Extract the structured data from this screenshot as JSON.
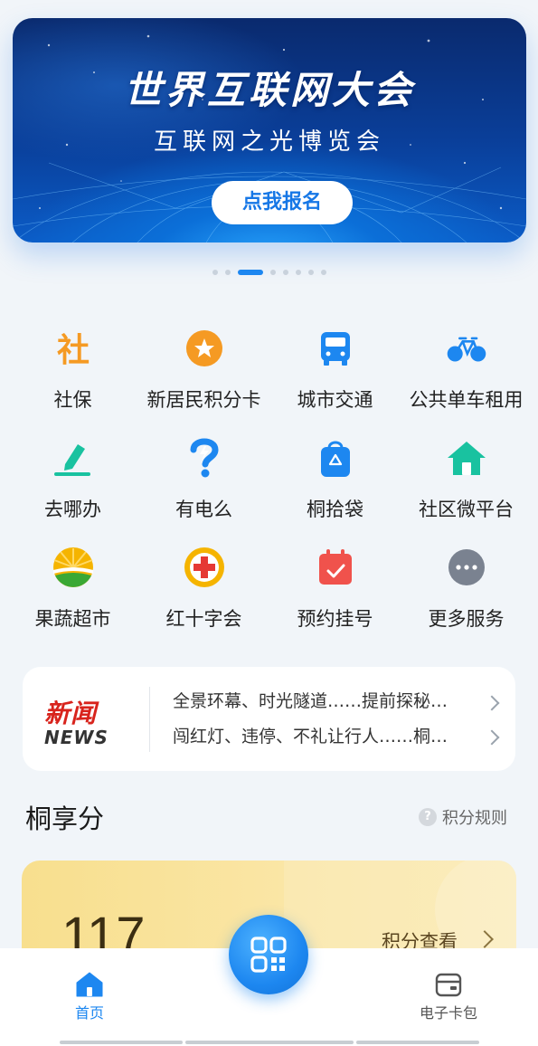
{
  "banner": {
    "title": "世界互联网大会",
    "subtitle": "互联网之光博览会",
    "button": "点我报名"
  },
  "carousel": {
    "count": 8,
    "active_index": 2
  },
  "services": [
    {
      "label": "社保",
      "icon": "social-security-icon",
      "color": "#f59a23"
    },
    {
      "label": "新居民积分卡",
      "icon": "star-badge-icon",
      "color": "#f59a23"
    },
    {
      "label": "城市交通",
      "icon": "bus-icon",
      "color": "#1d87f0"
    },
    {
      "label": "公共单车租用",
      "icon": "bicycle-icon",
      "color": "#1d87f0"
    },
    {
      "label": "去哪办",
      "icon": "pen-icon",
      "color": "#19c2a0"
    },
    {
      "label": "有电么",
      "icon": "question-bolt-icon",
      "color": "#1d87f0"
    },
    {
      "label": "桐拾袋",
      "icon": "recycle-bag-icon",
      "color": "#1d87f0"
    },
    {
      "label": "社区微平台",
      "icon": "house-icon",
      "color": "#19c2a0"
    },
    {
      "label": "果蔬超市",
      "icon": "produce-market-icon",
      "color": "#f5b400"
    },
    {
      "label": "红十字会",
      "icon": "red-cross-icon",
      "color": "#e53935"
    },
    {
      "label": "预约挂号",
      "icon": "calendar-check-icon",
      "color": "#f0524c"
    },
    {
      "label": "更多服务",
      "icon": "more-dots-icon",
      "color": "#7a8290"
    }
  ],
  "news": {
    "logo_cn": "新闻",
    "logo_en": "NEWS",
    "items": [
      "全景环幕、时光隧道……提前探秘…",
      "闯红灯、违停、不礼让行人……桐…"
    ]
  },
  "points_section": {
    "title": "桐享分",
    "rules_label": "积分规则",
    "value": "117",
    "link_label": "积分查看"
  },
  "tabbar": {
    "home_label": "首页",
    "wallet_label": "电子卡包"
  }
}
